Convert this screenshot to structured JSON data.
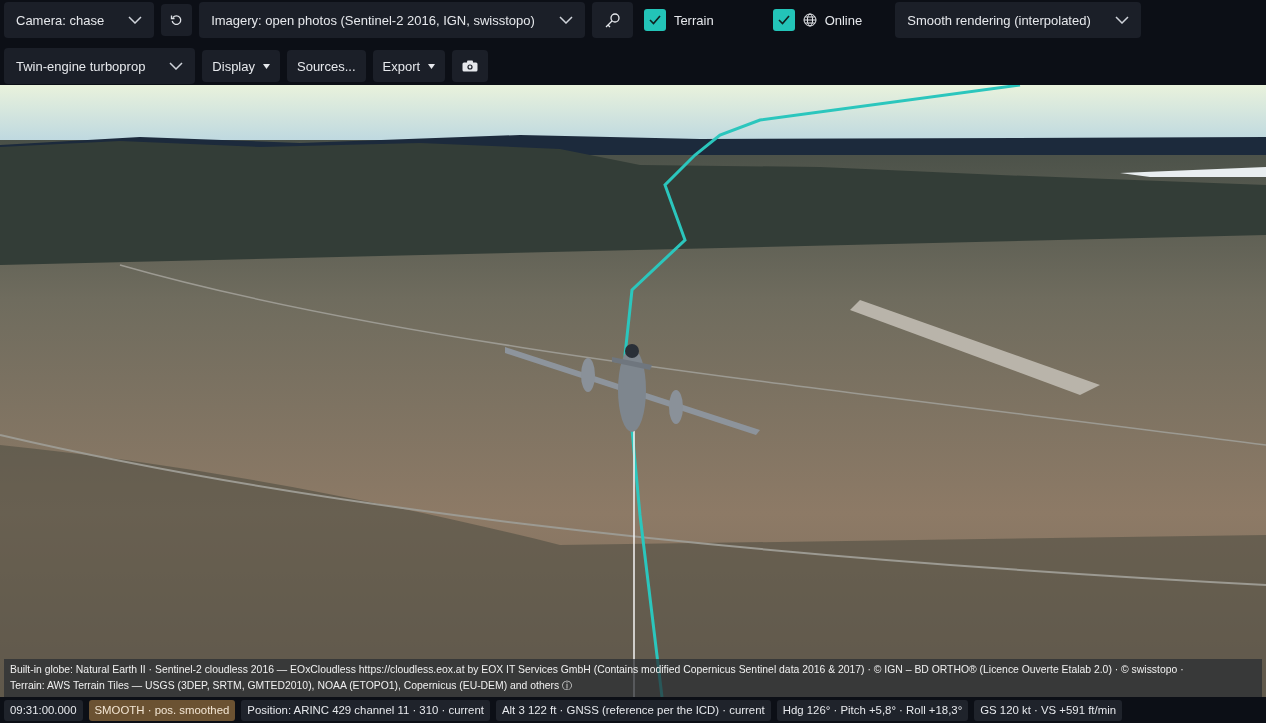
{
  "toolbar_rows": [
    [
      {
        "kind": "dropdown",
        "label": "Camera: chase"
      },
      {
        "kind": "reset-button"
      },
      {
        "kind": "dropdown",
        "label": "Imagery: open photos (Sentinel-2 2016, IGN, swisstopo)"
      },
      {
        "kind": "key-button"
      },
      {
        "kind": "checkbox",
        "label": "Terrain",
        "checked": true
      },
      {
        "kind": "globe-checkbox",
        "label": "Online",
        "checked": true
      },
      {
        "kind": "dropdown",
        "label": "Smooth rendering (interpolated)"
      }
    ],
    [
      {
        "kind": "dropdown",
        "label": "Twin-engine turboprop"
      },
      {
        "kind": "menu-button",
        "label": "Display"
      },
      {
        "kind": "button",
        "label": "Sources..."
      },
      {
        "kind": "menu-button",
        "label": "Export"
      },
      {
        "kind": "camera-button"
      }
    ]
  ],
  "attribution": [
    "Built-in globe: Natural Earth II · Sentinel-2 cloudless 2016 — EOxCloudless https://cloudless.eox.at by EOX IT Services GmbH (Contains modified Copernicus Sentinel data 2016 & 2017) · © IGN – BD ORTHO® (Licence Ouverte Etalab 2.0) · © swisstopo ·",
    "Terrain: AWS Terrain Tiles — USGS (3DEP, SRTM, GMTED2010), NOAA (ETOPO1), Copernicus (EU-DEM) and others ⓘ"
  ],
  "status_bar": [
    {
      "text": "09:31:00.000",
      "highlighted": false
    },
    {
      "text": "SMOOTH · pos. smoothed",
      "highlighted": true
    },
    {
      "text": "Position: ARINC 429 channel 11 · 310 · current",
      "highlighted": false
    },
    {
      "text": "Alt 3 122 ft · GNSS (reference per the ICD) · current",
      "highlighted": false
    },
    {
      "text": "Hdg 126° · Pitch +5,8° · Roll +18,3°",
      "highlighted": false
    },
    {
      "text": "GS 120 kt · VS +591 ft/min",
      "highlighted": false
    }
  ]
}
